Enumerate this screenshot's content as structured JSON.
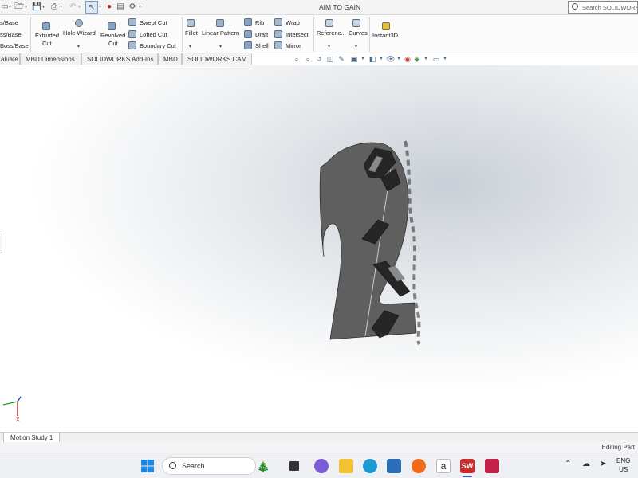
{
  "window": {
    "title": "AIM TO GAIN",
    "search_placeholder": "Search SOLIDWORKS"
  },
  "ribbon": {
    "boss_items": [
      "s/Base",
      "ss/Base",
      "Boss/Base"
    ],
    "extruded_cut": [
      "Extruded",
      "Cut"
    ],
    "hole_wizard": "Hole Wizard",
    "revolved_cut": [
      "Revolved",
      "Cut"
    ],
    "swept_cut": "Swept Cut",
    "lofted_cut": "Lofted Cut",
    "boundary_cut": "Boundary Cut",
    "fillet": "Fillet",
    "linear_pattern": "Linear Pattern",
    "rib": "Rib",
    "draft": "Draft",
    "shell": "Shell",
    "wrap": "Wrap",
    "intersect": "Intersect",
    "mirror": "Mirror",
    "reference": "Referenc...",
    "curves": "Curves",
    "instant3d": "Instant3D"
  },
  "tabs": [
    "aluate",
    "MBD Dimensions",
    "SOLIDWORKS Add-Ins",
    "MBD",
    "SOLIDWORKS CAM"
  ],
  "triad": {
    "x_label": "X"
  },
  "bottom": {
    "motion_tab": "Motion Study 1",
    "status": "Editing Part"
  },
  "taskbar": {
    "search_label": "Search",
    "lang_top": "ENG",
    "lang_bottom": "US"
  },
  "colors": {
    "part_fill": "#5f5f5f",
    "part_dark": "#262626",
    "accent_blue": "#2a6fb8"
  }
}
